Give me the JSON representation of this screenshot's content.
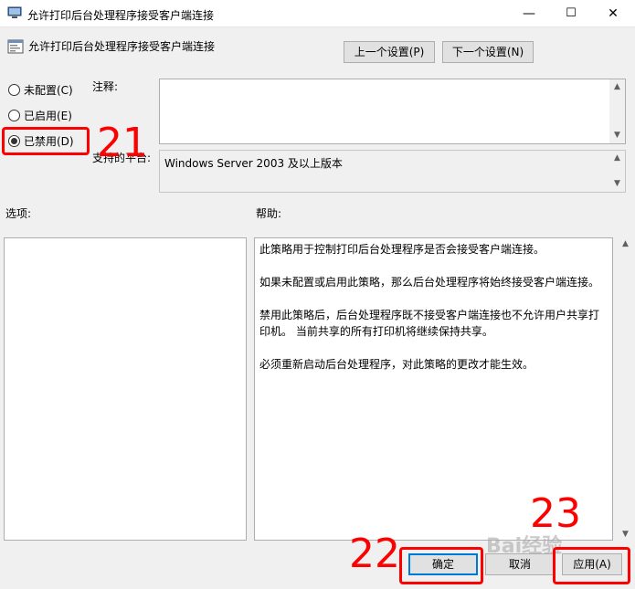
{
  "window": {
    "title": "允许打印后台处理程序接受客户端连接",
    "min_icon": "—",
    "max_icon": "☐",
    "close_icon": "✕"
  },
  "header": {
    "title": "允许打印后台处理程序接受客户端连接",
    "prev_label": "上一个设置(P)",
    "next_label": "下一个设置(N)"
  },
  "state": {
    "options": [
      {
        "label": "未配置(C)",
        "checked": false
      },
      {
        "label": "已启用(E)",
        "checked": false
      },
      {
        "label": "已禁用(D)",
        "checked": true
      }
    ]
  },
  "comment": {
    "label": "注释:",
    "value": ""
  },
  "supported": {
    "label": "支持的平台:",
    "value": "Windows Server 2003 及以上版本"
  },
  "options_panel": {
    "label": "选项:"
  },
  "help_panel": {
    "label": "帮助:",
    "paragraphs": [
      "此策略用于控制打印后台处理程序是否会接受客户端连接。",
      "如果未配置或启用此策略，那么后台处理程序将始终接受客户端连接。",
      "禁用此策略后，后台处理程序既不接受客户端连接也不允许用户共享打印机。 当前共享的所有打印机将继续保持共享。",
      "必须重新启动后台处理程序，对此策略的更改才能生效。"
    ]
  },
  "footer": {
    "ok_label": "确定",
    "cancel_label": "取消",
    "apply_label": "应用(A)"
  },
  "annotations": {
    "n21": "21",
    "n22": "22",
    "n23": "23"
  },
  "watermark": "Bai经验",
  "colors": {
    "annotation": "#ff0000",
    "accent": "#0078d7"
  }
}
